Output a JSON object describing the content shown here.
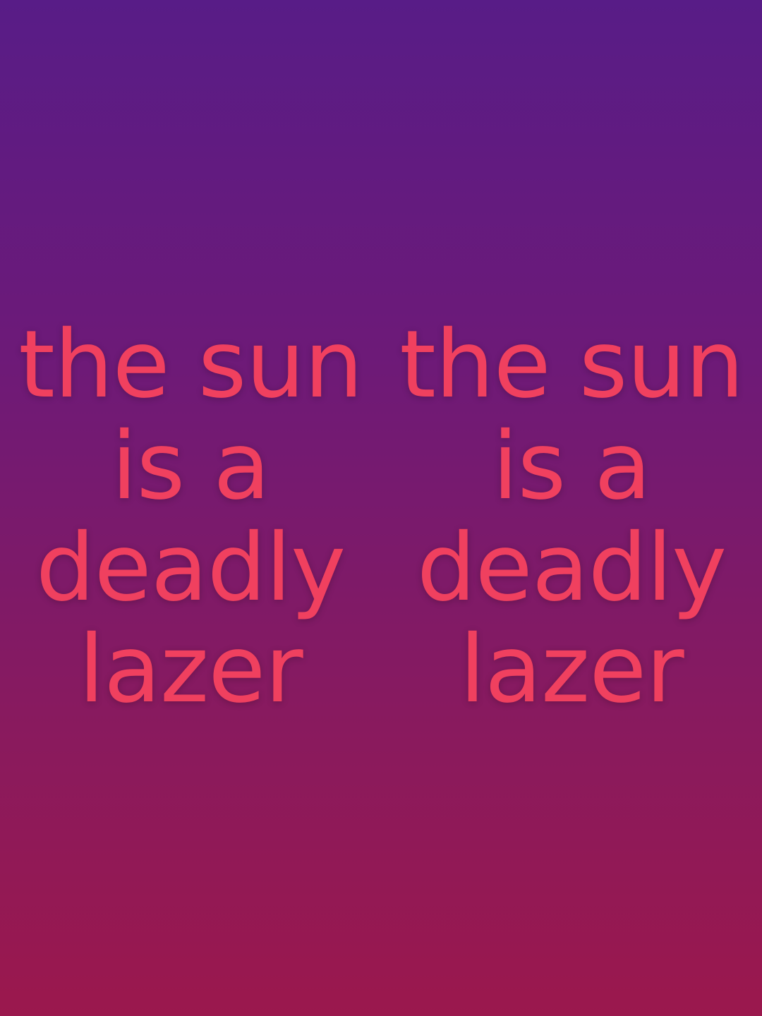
{
  "columns": [
    {
      "lines": [
        "the sun",
        "is a",
        "deadly",
        "lazer"
      ]
    },
    {
      "lines": [
        "the sun",
        "is a",
        "deadly",
        "lazer"
      ]
    }
  ],
  "colors": {
    "text": "#f0405f",
    "background_top": "#581c87",
    "background_bottom": "#9b184d"
  }
}
